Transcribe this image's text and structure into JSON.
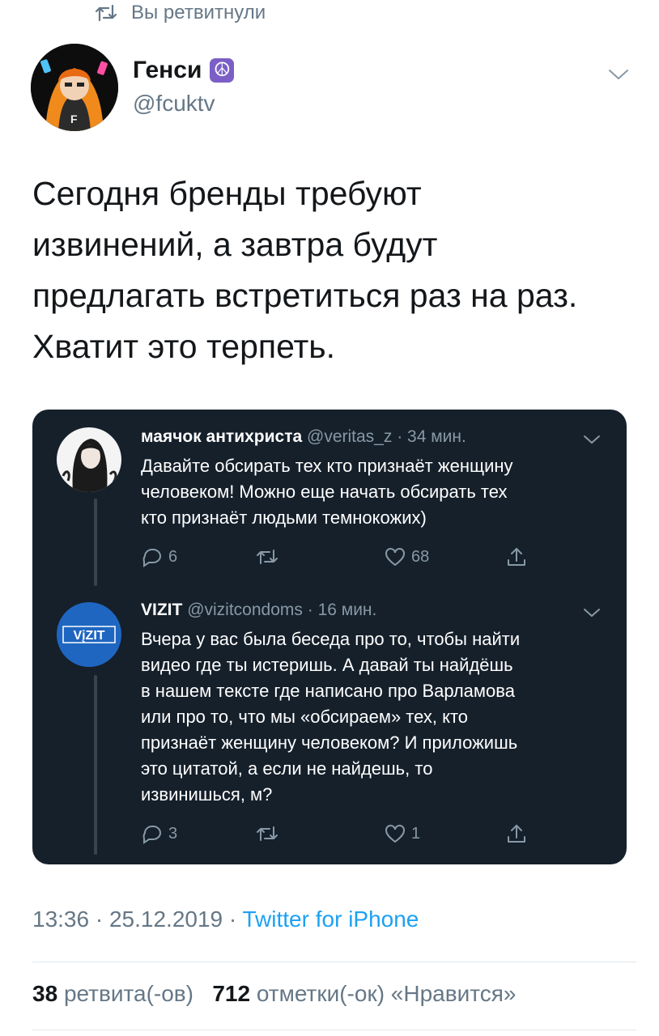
{
  "retweet_header": {
    "label": "Вы ретвитнули"
  },
  "tweet": {
    "author_name": "Генси",
    "author_badge": "☮",
    "author_handle": "@fcuktv",
    "text_lines": [
      "Сегодня бренды требуют",
      "извинений, а завтра будут",
      "предлагать встретиться раз на раз.",
      "Хватит это терпеть."
    ],
    "time": "13:36",
    "date": "25.12.2019",
    "source": "Twitter for iPhone",
    "retweets_count": "38",
    "retweets_label": "ретвита(-ов)",
    "likes_count": "712",
    "likes_label": "отметки(-ок) «Нравится»"
  },
  "quoted_thread": [
    {
      "name": "маячок антихриста",
      "handle": "@veritas_z",
      "time": "34 мин.",
      "body_lines": [
        "Давайте обсирать тех кто признаёт женщину",
        "человеком! Можно еще начать обсирать тех",
        "кто признаёт людьми темнокожих)"
      ],
      "replies": "6",
      "retweets": "",
      "likes": "68"
    },
    {
      "name": "VIZIT",
      "handle": "@vizitcondoms",
      "time": "16 мин.",
      "avatar_text": "VįZIT",
      "body_lines": [
        "Вчера у вас была беседа про то, чтобы найти",
        "видео где ты истеришь. А давай ты найдёшь",
        "в нашем тексте где написано про Варламова",
        "или про то, что мы «обсираем» тех, кто",
        "признаёт женщину человеком? И приложишь",
        "это цитатой, а если не найдешь, то",
        "извинишься, м?"
      ],
      "replies": "3",
      "retweets": "",
      "likes": "1"
    }
  ],
  "colors": {
    "card_bg": "#15202b",
    "accent": "#1da1f2",
    "secondary_text": "#657786",
    "vizit_blue": "#1f66c1",
    "avatar_orange": "#f08a1c"
  },
  "icons": [
    "retweet-icon",
    "chevron-down-icon",
    "reply-icon",
    "like-icon",
    "share-icon",
    "peace-icon"
  ]
}
